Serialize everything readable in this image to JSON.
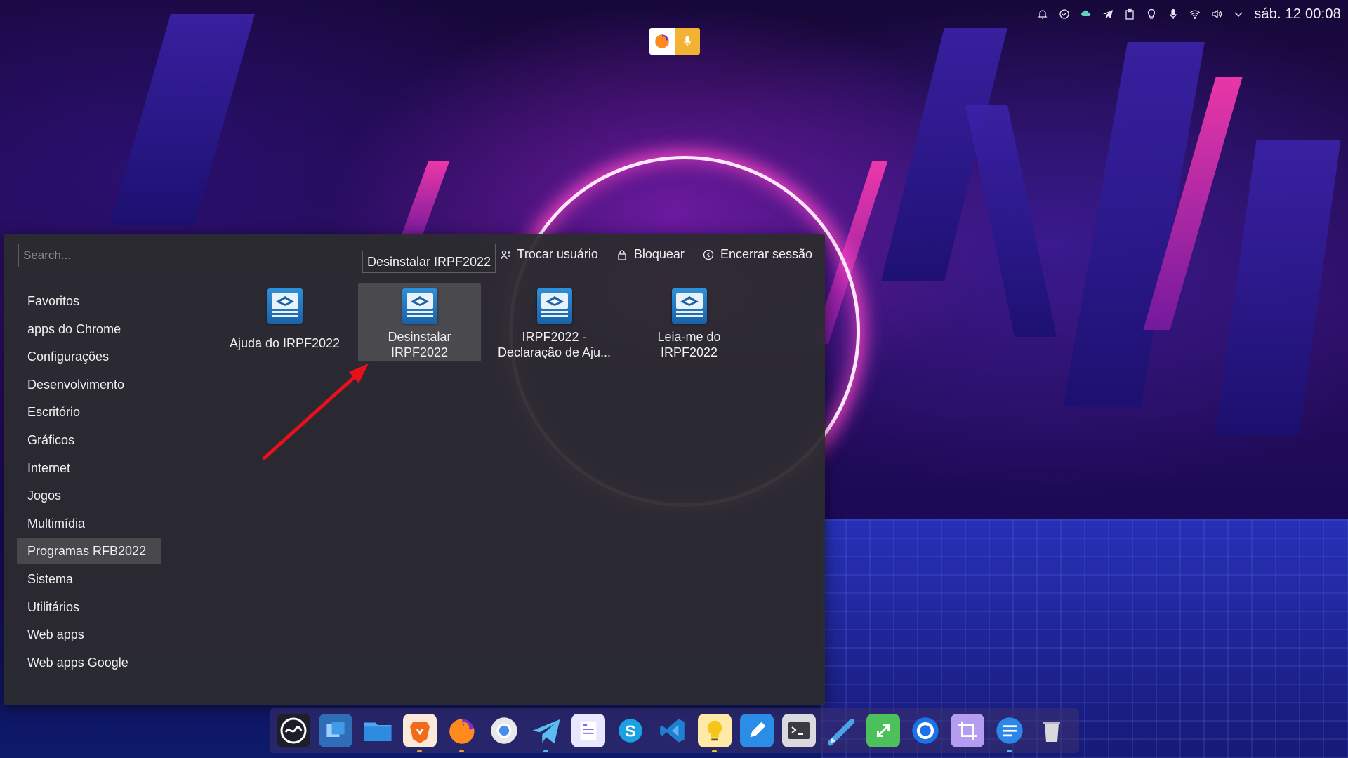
{
  "tray": {
    "clock": "sáb. 12 00:08",
    "icons": [
      "notification-icon",
      "check-circle-icon",
      "cloud-sync-icon",
      "telegram-icon",
      "clipboard-icon",
      "lightbulb-icon",
      "microphone-icon",
      "wifi-icon",
      "volume-icon",
      "chevron-down-icon"
    ]
  },
  "top_indicator": {
    "icons": [
      "firefox-icon",
      "microphone-icon"
    ],
    "colors": {
      "firefox": "#ff9a00",
      "mic": "#f2b233"
    }
  },
  "menu": {
    "search_placeholder": "Search...",
    "tooltip": "Desinstalar IRPF2022",
    "session_actions": [
      {
        "label": "Trocar usuário",
        "icon": "switch-user-icon"
      },
      {
        "label": "Bloquear",
        "icon": "lock-icon"
      },
      {
        "label": "Encerrar sessão",
        "icon": "logout-icon"
      }
    ],
    "categories": [
      {
        "label": "Favoritos"
      },
      {
        "label": "apps do Chrome"
      },
      {
        "label": "Configurações"
      },
      {
        "label": "Desenvolvimento"
      },
      {
        "label": "Escritório"
      },
      {
        "label": "Gráficos"
      },
      {
        "label": "Internet"
      },
      {
        "label": "Jogos"
      },
      {
        "label": "Multimídia"
      },
      {
        "label": "Programas RFB2022",
        "active": true
      },
      {
        "label": "Sistema"
      },
      {
        "label": "Utilitários"
      },
      {
        "label": "Web apps"
      },
      {
        "label": "Web apps Google"
      }
    ],
    "apps": [
      {
        "label": "Ajuda do IRPF2022",
        "icon": "receita-federal-icon"
      },
      {
        "label": "Desinstalar\nIRPF2022",
        "icon": "receita-federal-icon",
        "hover": true
      },
      {
        "label": "IRPF2022 -\nDeclaração de Aju...",
        "icon": "receita-federal-icon"
      },
      {
        "label": "Leia-me do\nIRPF2022",
        "icon": "receita-federal-icon"
      }
    ]
  },
  "dock": {
    "items": [
      {
        "name": "system-logo-icon",
        "color": "#1e1e2a"
      },
      {
        "name": "windows-switcher-icon",
        "color": "#2f6db8"
      },
      {
        "name": "files-icon",
        "color": "#3d8fe0"
      },
      {
        "name": "brave-icon",
        "color": "#f26a1b"
      },
      {
        "name": "firefox-icon",
        "color": "#ff7b22"
      },
      {
        "name": "chrome-icon",
        "color": "#e6e6e6"
      },
      {
        "name": "telegram-icon",
        "color": "#2ea6df"
      },
      {
        "name": "notes-icon",
        "color": "#7a6fe0"
      },
      {
        "name": "skype-icon",
        "color": "#1ba0e1"
      },
      {
        "name": "vscode-icon",
        "color": "#1f7fd0"
      },
      {
        "name": "ideas-icon",
        "color": "#f5c518"
      },
      {
        "name": "pen-icon",
        "color": "#2c8de6"
      },
      {
        "name": "terminal-icon",
        "color": "#3b3b44"
      },
      {
        "name": "text-editor-icon",
        "color": "#4aa3e8"
      },
      {
        "name": "connection-icon",
        "color": "#4cc05a"
      },
      {
        "name": "sync-icon",
        "color": "#1a73e8"
      },
      {
        "name": "screenshot-crop-icon",
        "color": "#8a63d2"
      },
      {
        "name": "messages-icon",
        "color": "#2b87e8"
      },
      {
        "name": "trash-icon",
        "color": "#b8b8c0"
      }
    ]
  }
}
